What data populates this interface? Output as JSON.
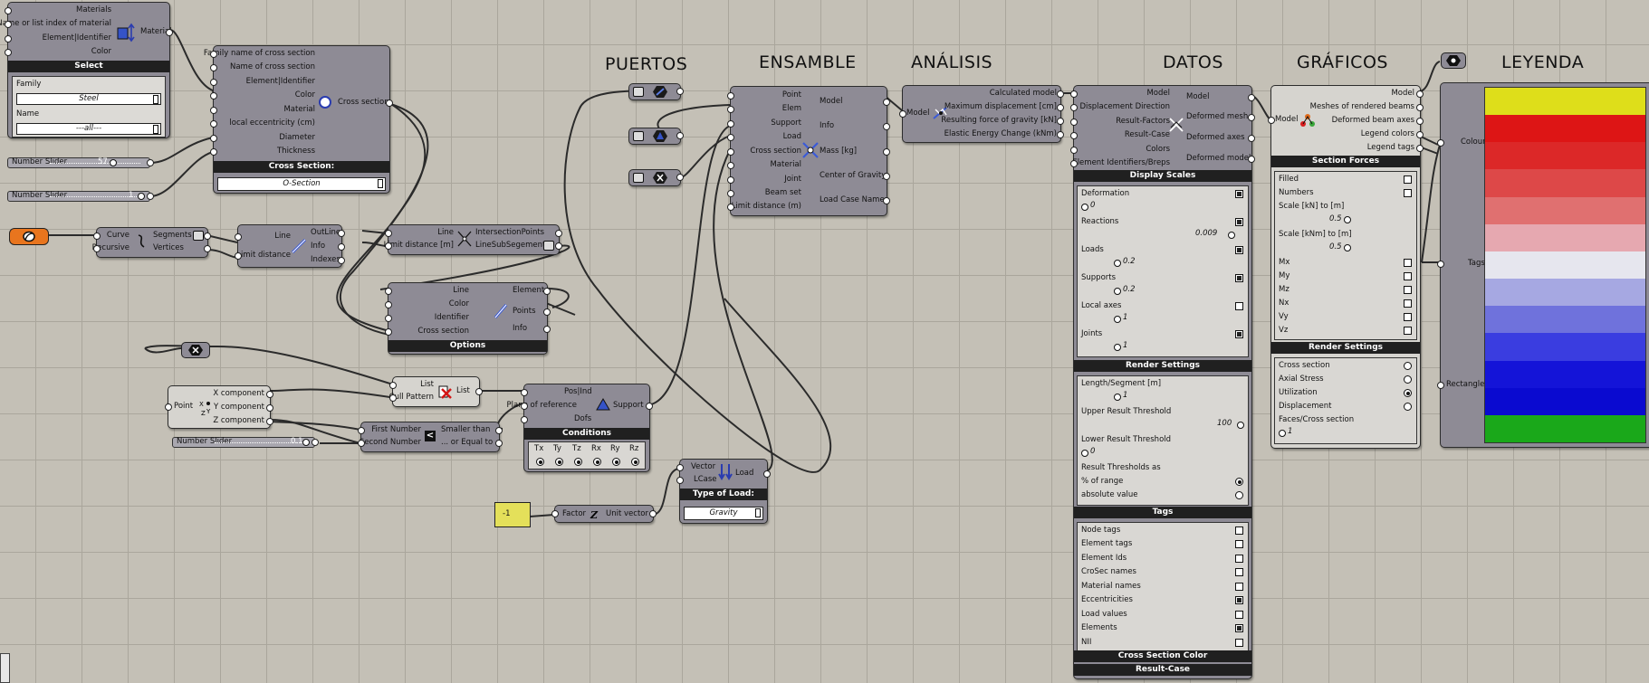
{
  "sections": {
    "puertos": "PUERTOS",
    "ensamble": "ENSAMBLE",
    "analisis": "ANÁLISIS",
    "datos": "DATOS",
    "graficos": "GRÁFICOS",
    "leyenda": "LEYENDA"
  },
  "material_select": {
    "inputs": [
      "Materials",
      "Name or list index of material",
      "Element|Identifier",
      "Color"
    ],
    "output": "Material",
    "title": "Select",
    "family_label": "Family",
    "family_value": "Steel",
    "name_label": "Name",
    "name_value": "---all---"
  },
  "cross_section": {
    "inputs": [
      "Family name of cross section",
      "Name of cross section",
      "Element|Identifier",
      "Color",
      "Material",
      "local eccentricity (cm)",
      "Diameter",
      "Thickness"
    ],
    "output": "Cross section",
    "title": "Cross Section:",
    "value": "O-Section"
  },
  "sliders": {
    "slider1": {
      "label": "Number Slider",
      "value": "57"
    },
    "slider2": {
      "label": "Number Slider",
      "value": "1"
    },
    "slider3": {
      "label": "Number Slider",
      "value": "0.1"
    }
  },
  "explode_curve": {
    "inputs": [
      "Curve",
      "Recursive"
    ],
    "outputs": [
      "Segments",
      "Vertices"
    ]
  },
  "line_to_beam": {
    "inputs": [
      "Line",
      "Limit distance"
    ],
    "outputs": [
      "OutLine",
      "Info",
      "Indexes"
    ]
  },
  "intersect": {
    "inputs": [
      "Line",
      "Limit distance [m]"
    ],
    "outputs": [
      "IntersectionPoints",
      "LineSubSegements"
    ]
  },
  "beam_options": {
    "inputs": [
      "Line",
      "Color",
      "Identifier",
      "Cross section"
    ],
    "outputs": [
      "Element",
      "Points",
      "Info"
    ],
    "title": "Options"
  },
  "deconstruct_point": {
    "input": "Point",
    "outputs": [
      "X component",
      "Y component",
      "Z component"
    ]
  },
  "cull": {
    "inputs": [
      "List",
      "Cull Pattern"
    ],
    "output": "List"
  },
  "smaller": {
    "inputs": [
      "First Number",
      "Second Number"
    ],
    "outputs": [
      "Smaller than",
      "... or Equal to"
    ]
  },
  "support": {
    "inputs": [
      "Pos|Ind",
      "Plane of reference",
      "Dofs"
    ],
    "output": "Support",
    "title": "Conditions",
    "dofs": [
      "Tx",
      "Ty",
      "Tz",
      "Rx",
      "Ry",
      "Rz"
    ]
  },
  "load": {
    "inputs": [
      "Vector",
      "LCase"
    ],
    "output": "Load",
    "title": "Type of Load:",
    "value": "Gravity"
  },
  "unit_vector": {
    "input": "Factor",
    "output": "Unit vector",
    "panel_value": "-1"
  },
  "assemble": {
    "inputs": [
      "Point",
      "Elem",
      "Support",
      "Load",
      "Cross section",
      "Material",
      "Joint",
      "Beam set",
      "Limit distance (m)"
    ],
    "outputs": [
      "Model",
      "Info",
      "Mass [kg]",
      "Center of Gravity",
      "Load Case Names"
    ]
  },
  "analysis": {
    "input": "Model",
    "outputs": [
      "Calculated model",
      "Maximum displacement [cm]",
      "Resulting force of gravity [kN]",
      "Elastic Energy Change (kNm)"
    ]
  },
  "model_view": {
    "inputs": [
      "Model",
      "Displacement Direction",
      "Result-Factors",
      "Result-Case",
      "Colors",
      "Element Identifiers/Breps"
    ],
    "outputs": [
      "Model",
      "Deformed mesh",
      "Deformed axes",
      "Deformed model"
    ],
    "display_title": "Display Scales",
    "display_rows": [
      {
        "label": "Deformation",
        "value": "0",
        "checked": true
      },
      {
        "label": "Reactions",
        "value": "0.009",
        "checked": true
      },
      {
        "label": "Loads",
        "value": "0.2",
        "checked": true
      },
      {
        "label": "Supports",
        "value": "0.2",
        "checked": true
      },
      {
        "label": "Local axes",
        "value": "1",
        "checked": false
      },
      {
        "label": "Joints",
        "value": "1",
        "checked": true
      }
    ],
    "render_title": "Render Settings",
    "length_label": "Length/Segment [m]",
    "length_value": "1",
    "upper_label": "Upper Result Threshold",
    "upper_value": "100",
    "lower_label": "Lower Result Threshold",
    "lower_value": "0",
    "thresholds_label": "Result Thresholds as",
    "thresholds_options": [
      {
        "label": "% of range",
        "on": true
      },
      {
        "label": "absolute value",
        "on": false
      }
    ],
    "tags_title": "Tags",
    "tags": [
      {
        "label": "Node tags",
        "on": false
      },
      {
        "label": "Element tags",
        "on": false
      },
      {
        "label": "Element Ids",
        "on": false
      },
      {
        "label": "CroSec names",
        "on": false
      },
      {
        "label": "Material names",
        "on": false
      },
      {
        "label": "Eccentricities",
        "on": true
      },
      {
        "label": "Load values",
        "on": false
      },
      {
        "label": "Elements",
        "on": true
      },
      {
        "label": "NII",
        "on": false
      }
    ],
    "crosec_color_title": "Cross Section Color",
    "result_case_title": "Result-Case"
  },
  "beam_view": {
    "input": "Model",
    "outputs": [
      "Model",
      "Meshes of rendered beams",
      "Deformed beam axes",
      "Legend colors",
      "Legend tags"
    ],
    "section_forces_title": "Section Forces",
    "forces": [
      {
        "label": "Filled",
        "on": false
      },
      {
        "label": "Numbers",
        "on": false
      }
    ],
    "scale_kn_label": "Scale [kN] to [m]",
    "scale_kn_value": "0.5",
    "scale_knm_label": "Scale [kNm] to [m]",
    "scale_knm_value": "0.5",
    "moments": [
      {
        "label": "Mx",
        "on": false
      },
      {
        "label": "My",
        "on": false
      },
      {
        "label": "Mz",
        "on": false
      },
      {
        "label": "Nx",
        "on": false
      },
      {
        "label": "Vy",
        "on": false
      },
      {
        "label": "Vz",
        "on": false
      }
    ],
    "render_title": "Render Settings",
    "render_options": [
      {
        "label": "Cross section",
        "on": false
      },
      {
        "label": "Axial Stress",
        "on": false
      },
      {
        "label": "Utilization",
        "on": true
      },
      {
        "label": "Displacement",
        "on": false
      }
    ],
    "faces_label": "Faces/Cross section",
    "faces_value": "1"
  },
  "legend": {
    "inputs": [
      "Colour",
      "Tags",
      "Rectangle"
    ],
    "colors": [
      "#dede1a",
      "#dd1515",
      "#dc2828",
      "#dd4848",
      "#e07070",
      "#e6a8b0",
      "#e6e6ee",
      "#a6a8e2",
      "#6f72dc",
      "#3a3de0",
      "#1414d8",
      "#0a0ad0",
      "#1aa81a"
    ]
  }
}
